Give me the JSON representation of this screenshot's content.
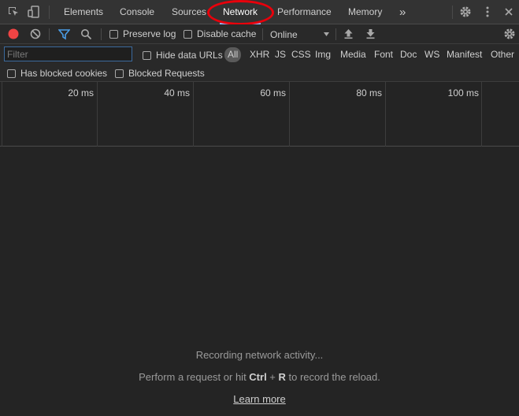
{
  "tabs": {
    "items": [
      "Elements",
      "Console",
      "Sources",
      "Network",
      "Performance",
      "Memory"
    ],
    "more": "»",
    "active": "Network"
  },
  "toolbar": {
    "preserve_log": "Preserve log",
    "disable_cache": "Disable cache",
    "throttle_value": "Online"
  },
  "filter": {
    "placeholder": "Filter",
    "hide_data_urls": "Hide data URLs",
    "types": [
      "All",
      "XHR",
      "JS",
      "CSS",
      "Img",
      "Media",
      "Font",
      "Doc",
      "WS",
      "Manifest",
      "Other"
    ],
    "has_blocked_cookies": "Has blocked cookies",
    "blocked_requests": "Blocked Requests"
  },
  "timeline": {
    "ticks": [
      "20 ms",
      "40 ms",
      "60 ms",
      "80 ms",
      "100 ms"
    ]
  },
  "empty_state": {
    "recording": "Recording network activity...",
    "hint_before": "Perform a request or hit ",
    "key_ctrl": "Ctrl",
    "key_plus": " + ",
    "key_r": "R",
    "hint_after": " to record the reload.",
    "learn_more": "Learn more"
  },
  "colors": {
    "record": "#ef4444",
    "filter_icon": "#4a9ee8",
    "highlight": "#e8000b"
  }
}
